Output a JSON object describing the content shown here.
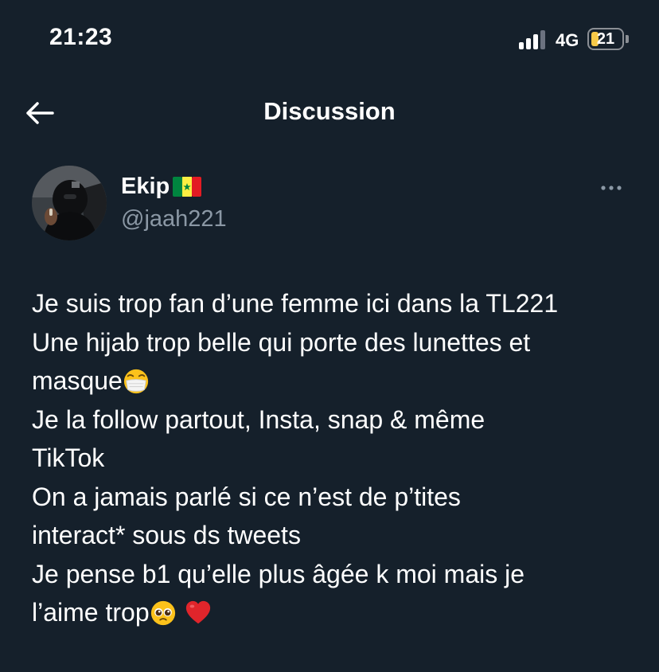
{
  "status_bar": {
    "time": "21:23",
    "network": "4G",
    "battery_level": "21",
    "signal_icon": "cellular-signal-icon",
    "battery_icon": "battery-icon"
  },
  "header": {
    "title": "Discussion",
    "back_icon": "arrow-left-icon"
  },
  "tweet": {
    "author": {
      "display_name": "Ekip",
      "name_flag_icon": "senegal-flag-icon",
      "handle": "@jaah221"
    },
    "more_icon": "more-horizontal-icon",
    "lines": [
      "Je suis trop fan d’une femme ici dans la TL221",
      "Une hijab trop belle qui porte des lunettes et",
      "masque",
      "Je la follow partout, Insta, snap & même",
      "TikTok",
      "On a jamais parlé si ce n’est de p’tites",
      "interact* sous ds tweets",
      "Je pense b1 qu’elle plus âgée k moi mais je",
      "l’aime trop"
    ],
    "emojis": [
      "face-with-medical-mask-emoji",
      "pleading-face-emoji",
      "red-heart-emoji"
    ]
  },
  "colors": {
    "background": "#15202b",
    "text_primary": "#ffffff",
    "text_secondary": "#8b98a5",
    "battery_fill": "#f7c948"
  }
}
